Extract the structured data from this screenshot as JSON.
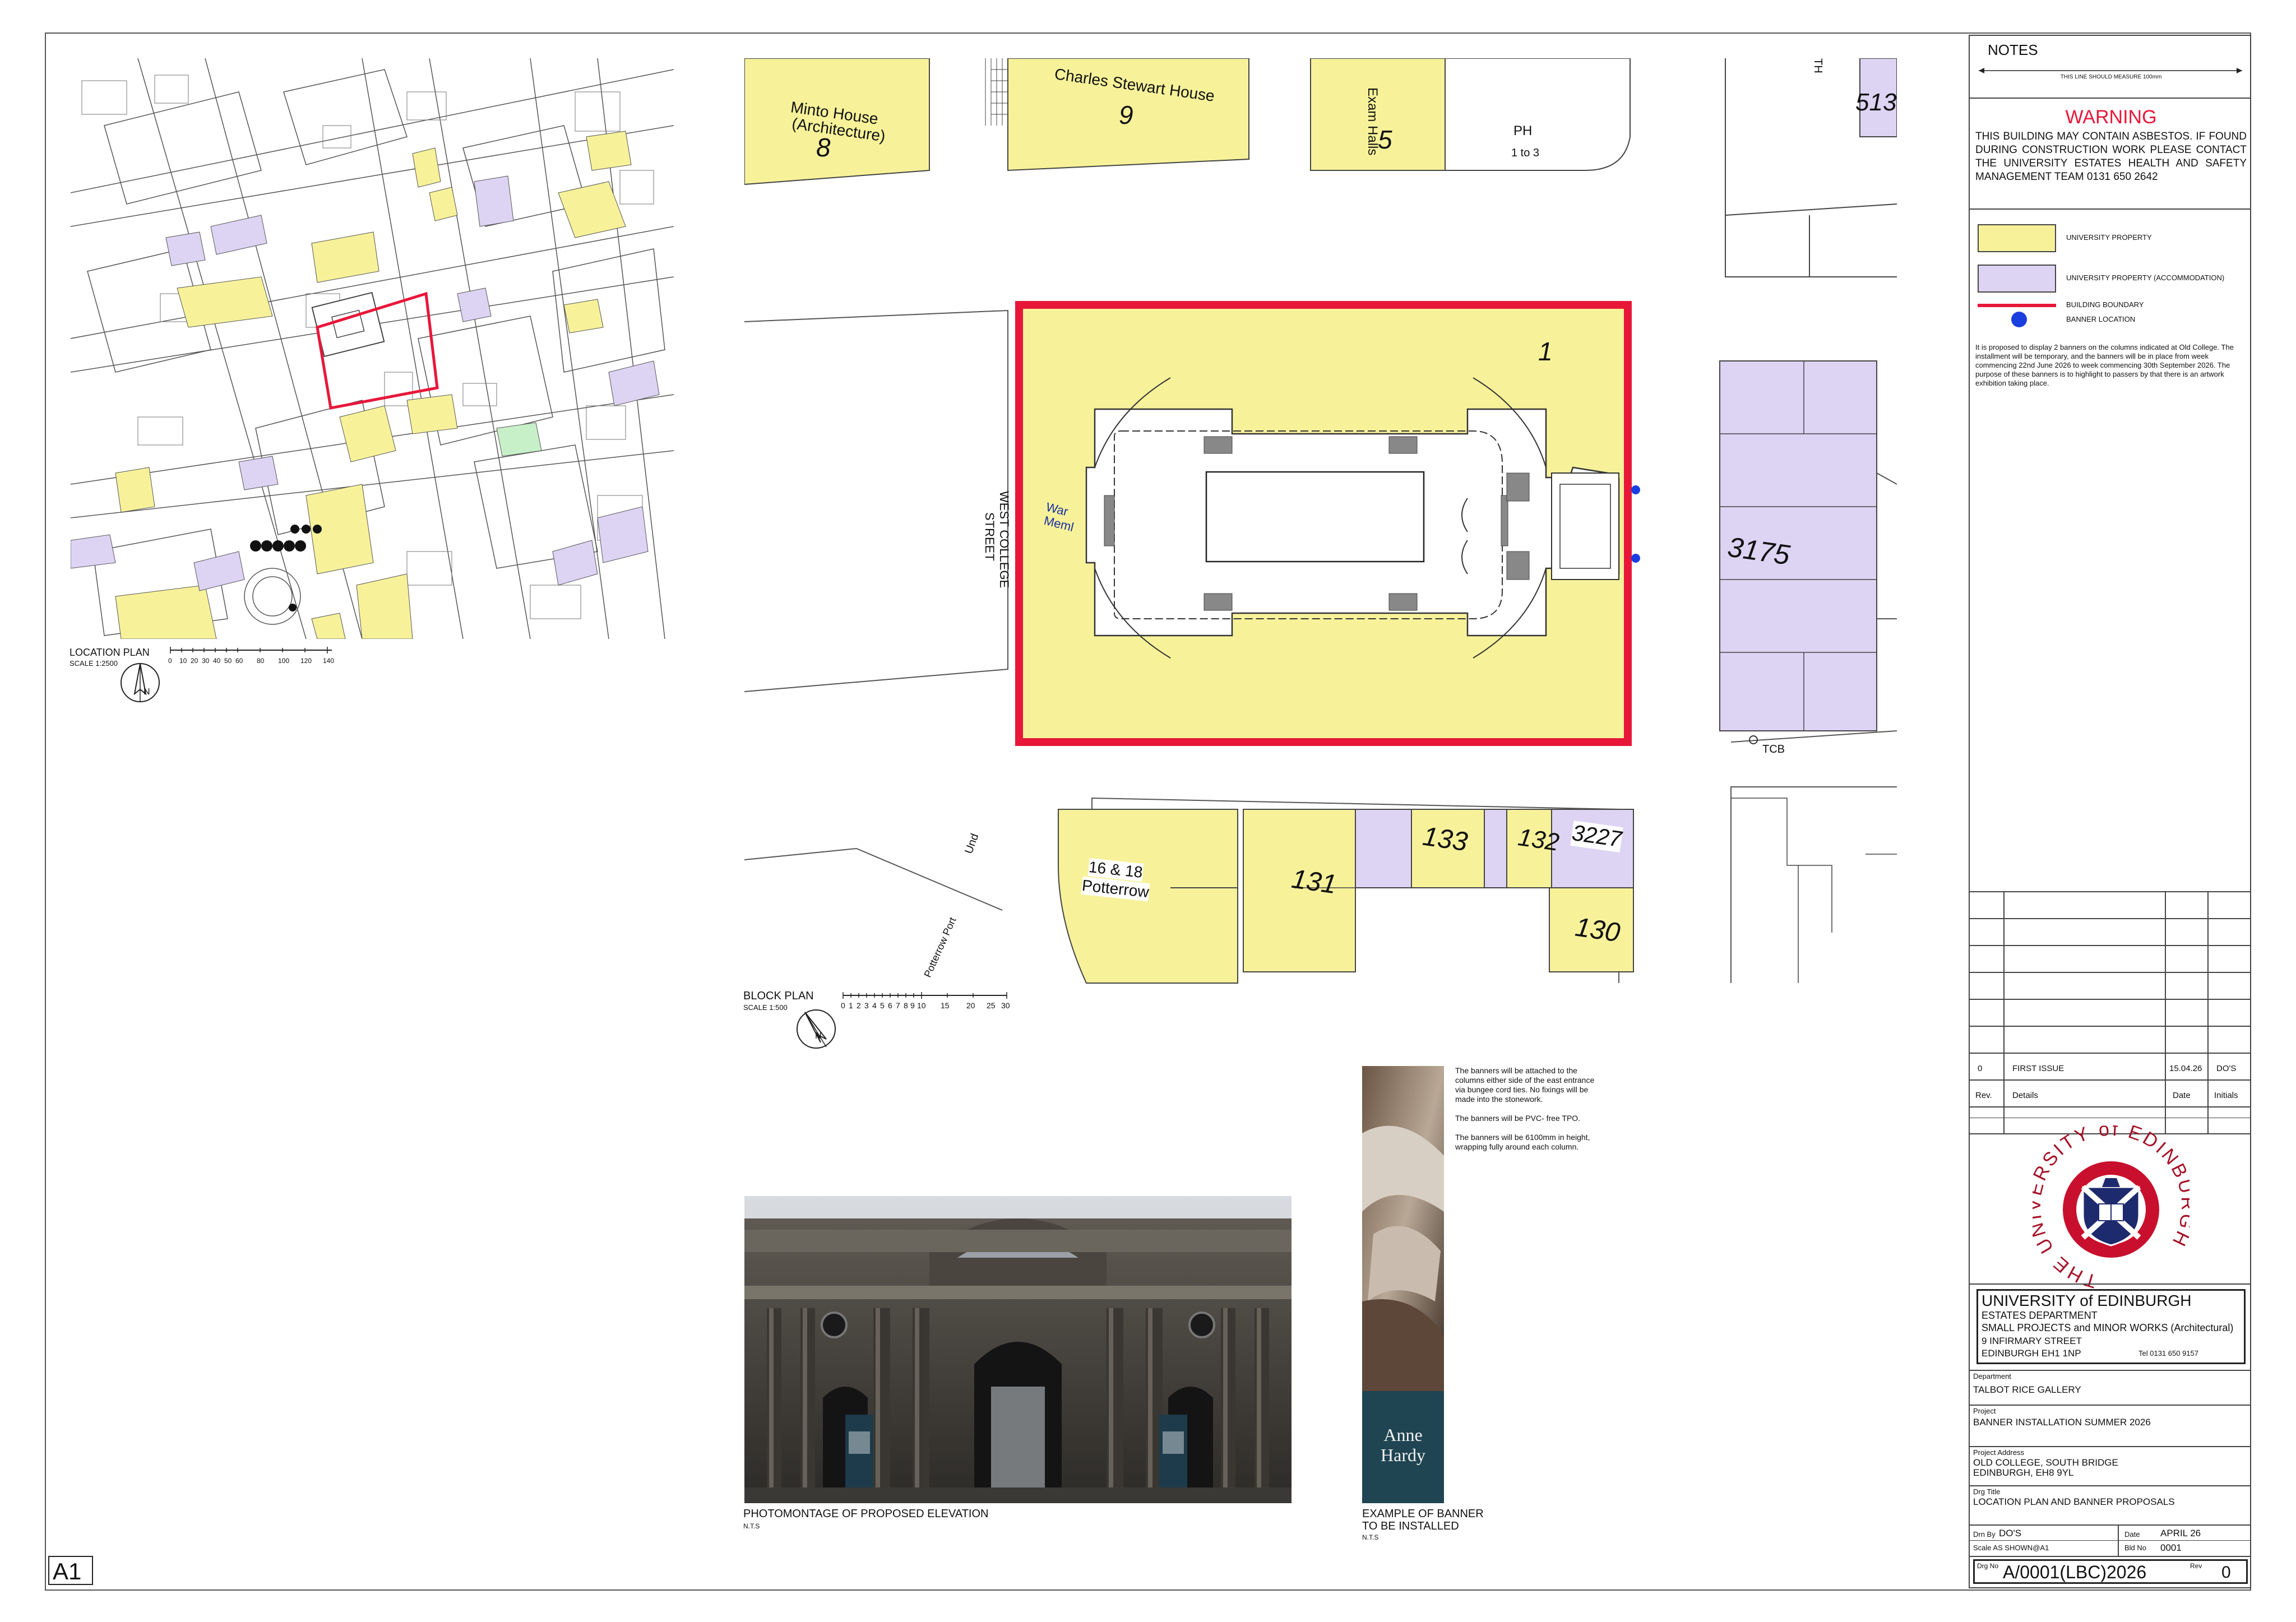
{
  "sheet": {
    "size_label": "A1"
  },
  "notes": {
    "title": "NOTES",
    "measure_line": "THIS LINE SHOULD MEASURE 100mm",
    "warning_title": "WARNING",
    "warning_body": "THIS BUILDING MAY CONTAIN ASBESTOS. IF FOUND DURING CONSTRUCTION WORK PLEASE CONTACT THE UNIVERSITY ESTATES HEALTH AND SAFETY MANAGEMENT TEAM 0131 650 2642",
    "legend": [
      {
        "label": "UNIVERSITY PROPERTY",
        "color": "#f7f29a"
      },
      {
        "label": "UNIVERSITY PROPERTY (ACCOMMODATION)",
        "color": "#ddd4f4"
      },
      {
        "label": "BUILDING BOUNDARY",
        "color": "#e8173a"
      },
      {
        "label": "BANNER LOCATION",
        "color": "#1a3fe0"
      }
    ],
    "description": "It is proposed to display 2 banners on the columns indicated at Old College. The installment will be temporary, and the banners will be in place from week commencing 22nd June 2026 to week commencing 30th September 2026. The purpose of these banners is to highlight to passers by that there is an artwork exhibition taking place."
  },
  "revisions": {
    "rows": [
      {
        "rev": "0",
        "details": "FIRST ISSUE",
        "date": "15.04.26",
        "initials": "DO'S"
      }
    ],
    "headers": {
      "rev": "Rev.",
      "details": "Details",
      "date": "Date",
      "initials": "Initials"
    }
  },
  "logo": {
    "ring_text": "THE UNIVERSITY of EDINBURGH"
  },
  "title_block": {
    "org": "UNIVERSITY of EDINBURGH",
    "dept": "ESTATES DEPARTMENT",
    "team": "SMALL PROJECTS and MINOR WORKS (Architectural)",
    "address1": "9 INFIRMARY STREET",
    "address2": "EDINBURGH EH1 1NP",
    "tel": "Tel 0131 650 9157",
    "department_label": "Department",
    "department": "TALBOT RICE GALLERY",
    "project_label": "Project",
    "project": "BANNER INSTALLATION SUMMER 2026",
    "address_label": "Project Address",
    "project_address1": "OLD COLLEGE, SOUTH BRIDGE",
    "project_address2": "EDINBURGH, EH8 9YL",
    "drg_title_label": "Drg Title",
    "drg_title": "LOCATION PLAN AND BANNER PROPOSALS",
    "drn_by_label": "Drn By",
    "drn_by": "DO'S",
    "date_label": "Date",
    "date": "APRIL 26",
    "scale": "Scale AS SHOWN@A1",
    "bld_no_label": "Bld No",
    "bld_no": "0001",
    "drg_no_label": "Drg No",
    "drg_no": "A/0001(LBC)2026",
    "rev_label": "Rev",
    "rev": "0"
  },
  "location_plan": {
    "title": "LOCATION PLAN",
    "scale": "SCALE 1:2500",
    "scale_ticks": [
      "0",
      "10",
      "20",
      "30",
      "40",
      "50",
      "60",
      "80",
      "100",
      "120",
      "140"
    ],
    "north": "N"
  },
  "block_plan": {
    "title": "BLOCK PLAN",
    "scale": "SCALE 1:500",
    "scale_ticks": [
      "0",
      "1",
      "2",
      "3",
      "4",
      "5",
      "6",
      "7",
      "8",
      "9",
      "10",
      "15",
      "20",
      "25",
      "30"
    ],
    "north": "N",
    "labels": {
      "minto": "Minto House",
      "minto2": "(Architecture)",
      "minto_no": "8",
      "charles": "Charles Stewart House",
      "charles_no": "9",
      "exam": "Exam Halls",
      "exam_no": "5",
      "ph": "PH",
      "one_to_three": "1 to 3",
      "b513": "513",
      "th": "TH",
      "old_college_no": "1",
      "war_memorial": "War",
      "war_memorial2": "Meml",
      "west_college": "WEST COLLEGE",
      "street": "STREET",
      "b3175": "3175",
      "tcb": "TCB",
      "potterrow_no": "16 & 18",
      "potterrow": "Potterrow",
      "b131": "131",
      "b133": "133",
      "b132": "132",
      "b3227": "3227",
      "b130": "130",
      "und": "Und",
      "potterrow_port": "Potterrow Port"
    }
  },
  "photomontage": {
    "caption": "PHOTOMONTAGE OF PROPOSED ELEVATION",
    "nts": "N.T.S"
  },
  "banner_example": {
    "caption1": "EXAMPLE OF BANNER",
    "caption2": "TO BE INSTALLED",
    "nts": "N.T.S",
    "artist": "Anne Hardy",
    "notes1": "The banners will be attached to the columns either side of the east entrance via bungee cord ties. No fixings will be made into the stonework.",
    "notes2": "The banners will be PVC- free TPO.",
    "notes3": "The banners will be 6100mm in height, wrapping fully around each column."
  }
}
